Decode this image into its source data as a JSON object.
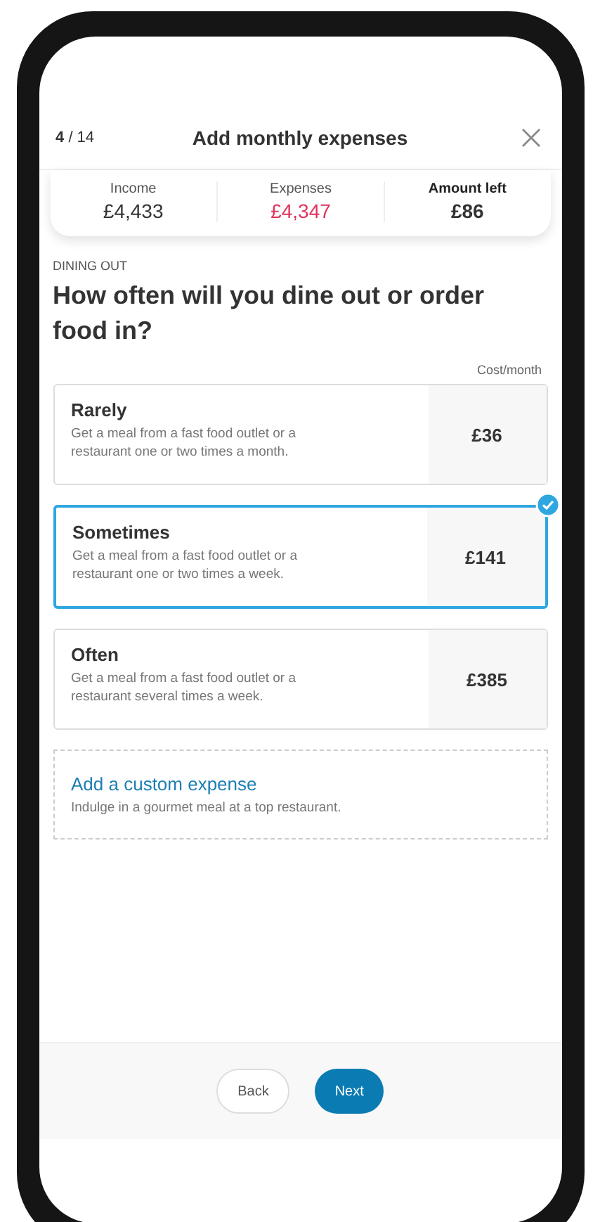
{
  "header": {
    "step": "4",
    "total": "/ 14",
    "title": "Add monthly expenses"
  },
  "summary": [
    {
      "label": "Income",
      "value": "£4,433",
      "kind": "normal"
    },
    {
      "label": "Expenses",
      "value": "£4,347",
      "kind": "negative"
    },
    {
      "label": "Amount left",
      "value": "£86",
      "kind": "strong"
    }
  ],
  "question": {
    "category": "DINING OUT",
    "title": "How often will you dine out or order food in?",
    "column_label": "Cost/month"
  },
  "options": [
    {
      "title": "Rarely",
      "description": "Get a meal from a fast food outlet or a restaurant one or two times a month.",
      "cost": "£36",
      "selected": false
    },
    {
      "title": "Sometimes",
      "description": "Get a meal from a fast food outlet or a restaurant one or two times a week.",
      "cost": "£141",
      "selected": true
    },
    {
      "title": "Often",
      "description": "Get a meal from a fast food outlet or a restaurant several times a week.",
      "cost": "£385",
      "selected": false
    }
  ],
  "custom": {
    "title": "Add a custom expense",
    "description": "Indulge in a gourmet meal at a top restaurant."
  },
  "buttons": [
    {
      "label": "Back",
      "kind": "secondary"
    },
    {
      "label": "Next",
      "kind": "primary"
    }
  ]
}
